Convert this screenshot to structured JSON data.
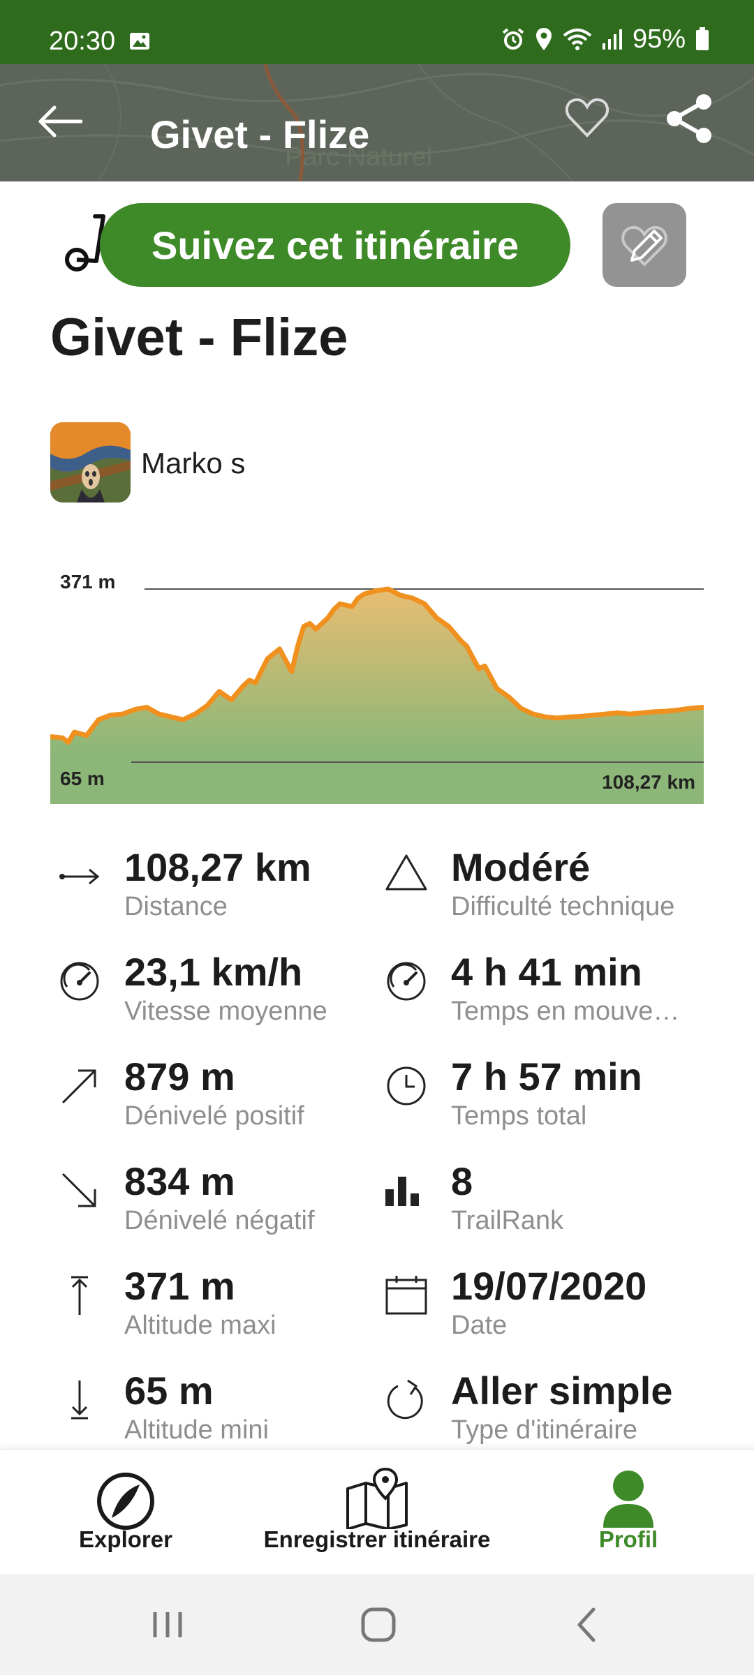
{
  "status_bar": {
    "time": "20:30",
    "battery": "95%"
  },
  "header": {
    "title": "Givet - Flize",
    "map_label": "Parc Naturel"
  },
  "actions": {
    "follow_label": "Suivez cet itinéraire"
  },
  "route": {
    "title": "Givet - Flize",
    "author": "Marko s"
  },
  "chart_data": {
    "type": "area",
    "x": [
      0,
      2,
      3,
      4,
      6,
      8,
      10,
      12,
      14,
      16,
      18,
      20,
      22,
      24,
      26,
      28,
      30,
      32,
      33,
      34,
      36,
      38,
      40,
      41,
      42,
      43,
      44,
      46,
      47,
      48,
      50,
      51,
      52,
      54,
      56,
      58,
      60,
      62,
      64,
      66,
      68,
      69,
      70,
      71,
      72,
      74,
      76,
      78,
      80,
      82,
      84,
      86,
      88,
      90,
      92,
      94,
      96,
      98,
      100,
      102,
      104,
      106,
      108.27
    ],
    "y": [
      110,
      108,
      100,
      118,
      112,
      140,
      148,
      150,
      158,
      162,
      150,
      145,
      140,
      150,
      165,
      190,
      175,
      200,
      210,
      205,
      248,
      265,
      225,
      270,
      305,
      310,
      300,
      320,
      335,
      345,
      340,
      355,
      362,
      368,
      371,
      360,
      355,
      345,
      320,
      305,
      280,
      270,
      250,
      230,
      235,
      195,
      180,
      160,
      150,
      145,
      143,
      145,
      146,
      148,
      150,
      152,
      150,
      152,
      154,
      155,
      157,
      160,
      162
    ],
    "ylim": [
      65,
      371
    ],
    "ytick_labels": [
      "65 m",
      "371 m"
    ],
    "xtick_labels": [
      "108,27 km"
    ],
    "grid": false,
    "colors": {
      "line": "#f0901e",
      "fill_top": "#e8bd72",
      "fill_bottom": "#8db778"
    }
  },
  "stats": [
    {
      "icon": "distance-icon",
      "value": "108,27 km",
      "label": "Distance"
    },
    {
      "icon": "difficulty-icon",
      "value": "Modéré",
      "label": "Difficulté technique"
    },
    {
      "icon": "speedometer-icon",
      "value": "23,1 km/h",
      "label": "Vitesse moyenne"
    },
    {
      "icon": "speedometer-icon",
      "value": "4 h 41 min",
      "label": "Temps en mouve…"
    },
    {
      "icon": "uphill-arrow-icon",
      "value": "879 m",
      "label": "Dénivelé positif"
    },
    {
      "icon": "clock-icon",
      "value": "7 h 57 min",
      "label": "Temps total"
    },
    {
      "icon": "downhill-arrow-icon",
      "value": "834 m",
      "label": "Dénivelé négatif"
    },
    {
      "icon": "bar-chart-icon",
      "value": "8",
      "label": "TrailRank"
    },
    {
      "icon": "max-altitude-icon",
      "value": "371 m",
      "label": "Altitude maxi"
    },
    {
      "icon": "calendar-icon",
      "value": "19/07/2020",
      "label": "Date"
    },
    {
      "icon": "min-altitude-icon",
      "value": "65 m",
      "label": "Altitude mini"
    },
    {
      "icon": "one-way-icon",
      "value": "Aller simple",
      "label": "Type d'itinéraire"
    }
  ],
  "bottom_nav": {
    "explore": "Explorer",
    "record": "Enregistrer itinéraire",
    "profile": "Profil"
  },
  "colors": {
    "brand_green": "#3f8a28",
    "status_green": "#2f6b1c",
    "muted_text": "#8e8e8e"
  }
}
